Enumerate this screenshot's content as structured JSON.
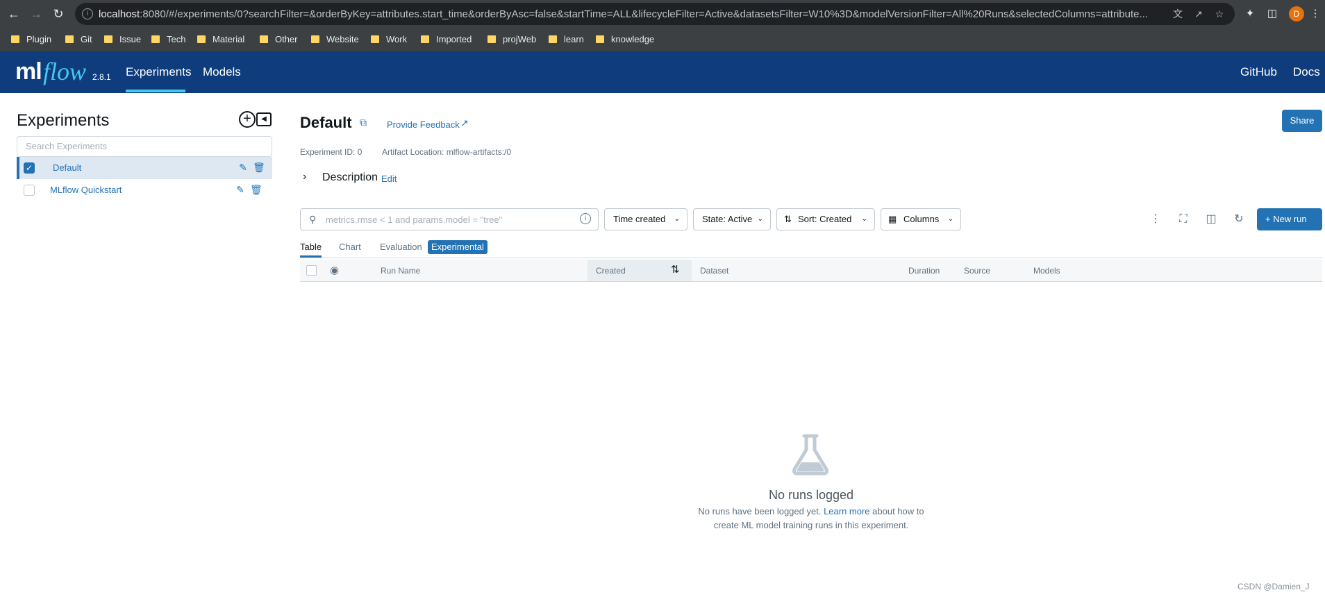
{
  "browser": {
    "url_host": "localhost",
    "url_rest": ":8080/#/experiments/0?searchFilter=&orderByKey=attributes.start_time&orderByAsc=false&startTime=ALL&lifecycleFilter=Active&datasetsFilter=W10%3D&modelVersionFilter=All%20Runs&selectedColumns=attribute...",
    "avatar_letter": "D",
    "bookmarks": [
      "Plugin",
      "Git",
      "Issue",
      "Tech",
      "Material",
      "Other",
      "Website",
      "Work",
      "Imported",
      "projWeb",
      "learn",
      "knowledge"
    ],
    "folder_color": "#fdd663"
  },
  "header": {
    "logo_ml": "ml",
    "logo_flow": "flow",
    "version": "2.8.1",
    "nav": [
      "Experiments",
      "Models"
    ],
    "right_links": [
      "GitHub",
      "Docs"
    ],
    "bg_color": "#0e3c7d",
    "accent_color": "#43c9ed"
  },
  "sidebar": {
    "title": "Experiments",
    "search_placeholder": "Search Experiments",
    "experiments": [
      {
        "name": "Default",
        "selected": true
      },
      {
        "name": "MLflow Quickstart",
        "selected": false
      }
    ]
  },
  "main": {
    "title": "Default",
    "feedback_link": "Provide Feedback",
    "share_label": "Share",
    "experiment_id": "Experiment ID: 0",
    "artifact_location": "Artifact Location: mlflow-artifacts:/0",
    "description_label": "Description",
    "description_edit": "Edit",
    "search_placeholder": "metrics.rmse < 1 and params.model = \"tree\"",
    "time_filter": "Time created",
    "state_filter": "State: Active",
    "sort": "Sort: Created",
    "columns": "Columns",
    "new_run": "New run",
    "tabs": [
      "Table",
      "Chart",
      "Evaluation",
      "Experimental"
    ],
    "columns_header": [
      "Run Name",
      "Created",
      "Dataset",
      "Duration",
      "Source",
      "Models"
    ],
    "empty_title": "No runs logged",
    "empty_line1_pre": "No runs have been logged yet.",
    "empty_link": "Learn more",
    "empty_line1_post": "about how to",
    "empty_line2": "create ML model training runs in this experiment.",
    "primary_color": "#2272b4"
  },
  "watermark": "CSDN @Damien_J"
}
